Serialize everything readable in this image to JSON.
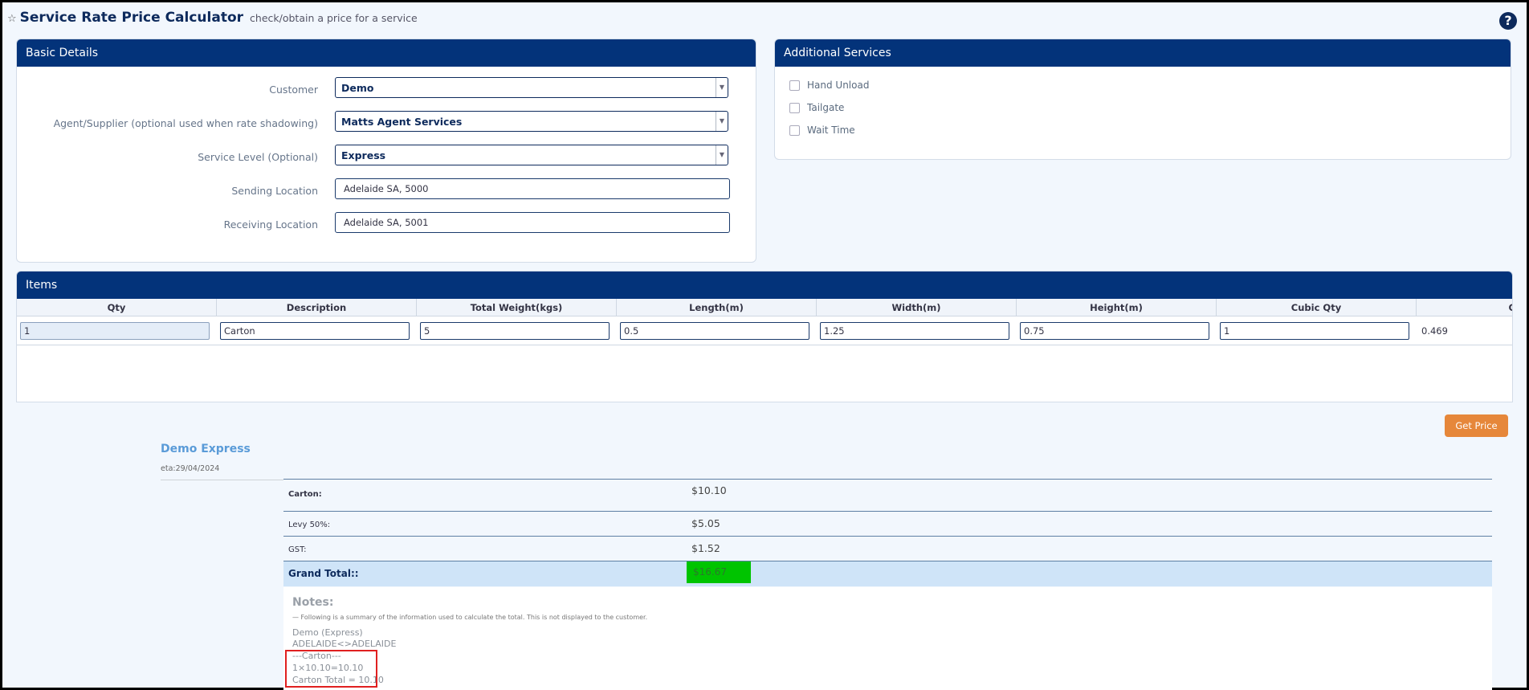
{
  "header": {
    "title": "Service Rate Price Calculator",
    "subtitle": "check/obtain a price for a service",
    "help": "?"
  },
  "basic": {
    "title": "Basic Details",
    "customer": {
      "label": "Customer",
      "value": "Demo"
    },
    "agent": {
      "label": "Agent/Supplier (optional used when rate shadowing)",
      "value": "Matts Agent Services"
    },
    "service": {
      "label": "Service Level (Optional)",
      "value": "Express"
    },
    "sending": {
      "label": "Sending Location",
      "value": "Adelaide SA, 5000"
    },
    "receiving": {
      "label": "Receiving Location",
      "value": "Adelaide SA, 5001"
    }
  },
  "additional": {
    "title": "Additional Services",
    "items": [
      "Hand Unload",
      "Tailgate",
      "Wait Time"
    ]
  },
  "items": {
    "title": "Items",
    "headers": [
      "Qty",
      "Description",
      "Total Weight(kgs)",
      "Length(m)",
      "Width(m)",
      "Height(m)",
      "Cubic Qty",
      "C"
    ],
    "row": [
      "1",
      "Carton",
      "5",
      "0.5",
      "1.25",
      "0.75",
      "1",
      "0.469"
    ]
  },
  "actions": {
    "get_price": "Get Price"
  },
  "result": {
    "title": "Demo Express",
    "eta": "eta:29/04/2024",
    "carton_label": "Carton:",
    "carton_value": "$10.10",
    "levy_label": "Levy 50%:",
    "levy_value": "$5.05",
    "gst_label": "GST:",
    "gst_value": "$1.52",
    "total_label": "Grand Total::",
    "total_value": "$16.67"
  },
  "notes": {
    "title": "Notes:",
    "subtitle": "— Following is a summary of the information used to calculate the total. This is not displayed to the customer.",
    "lines": [
      "Demo (Express)",
      "ADELAIDE<>ADELAIDE",
      "---Carton---",
      "1×10.10=10.10",
      "Carton Total = 10.10"
    ]
  },
  "colors": {
    "header_bar": "#03337a",
    "accent_button": "#e6873a",
    "total_highlight": "#00c400"
  }
}
